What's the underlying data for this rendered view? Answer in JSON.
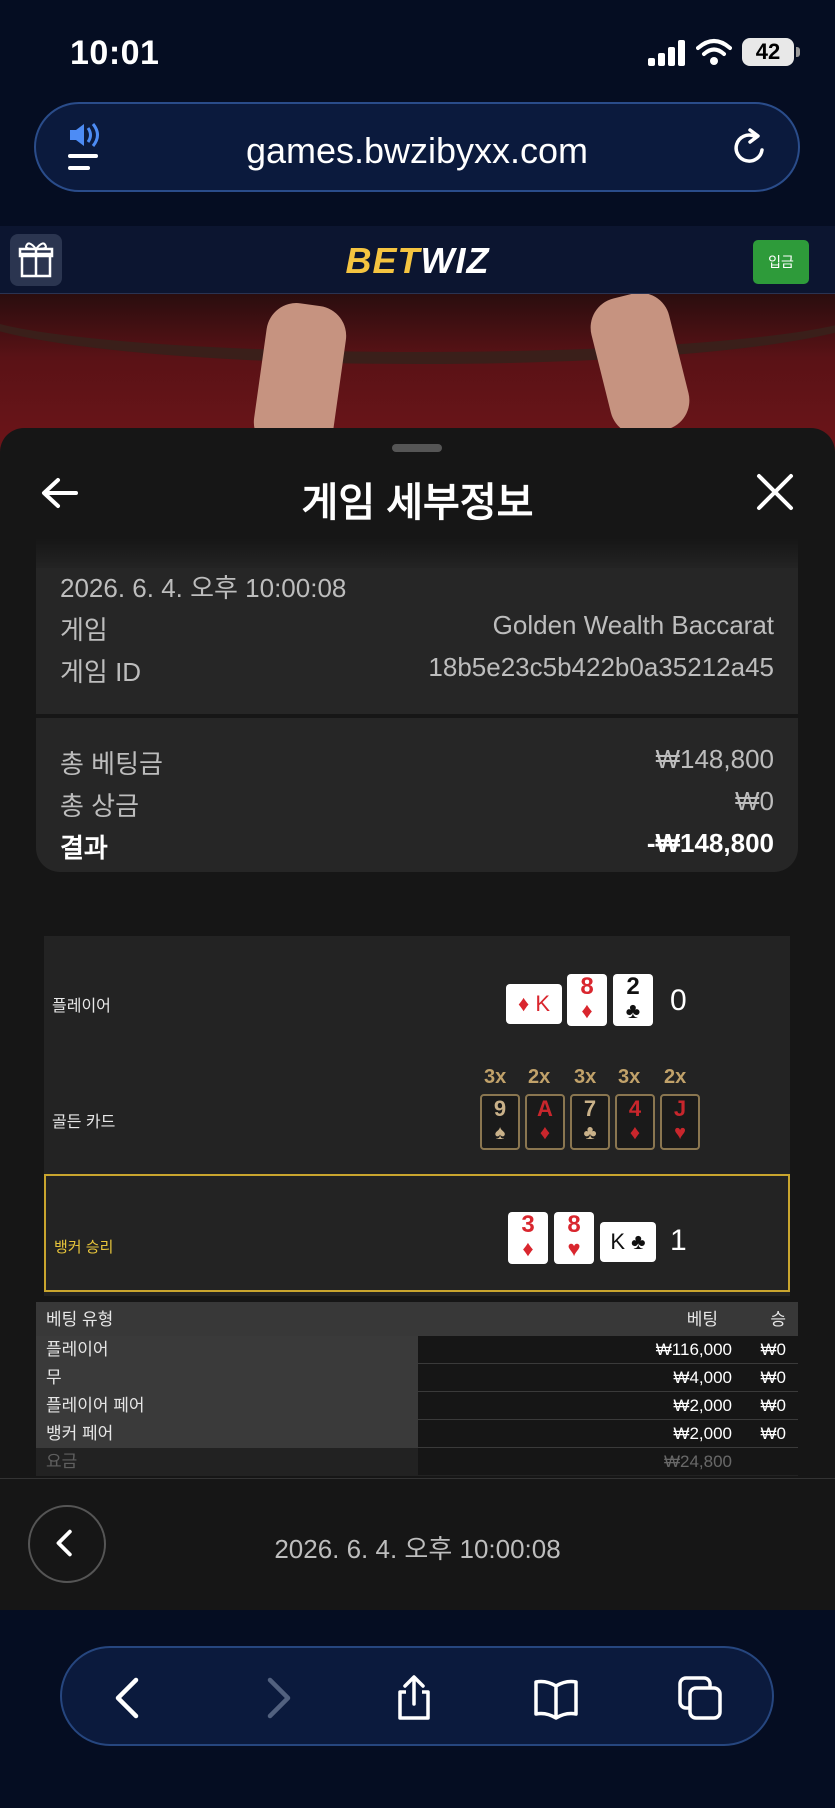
{
  "status_bar": {
    "time": "10:01",
    "battery": "42"
  },
  "browser": {
    "url": "games.bwzibyxx.com"
  },
  "site": {
    "logo_bet": "BET",
    "logo_wiz": "WIZ",
    "deposit_label": "입금"
  },
  "sheet": {
    "title": "게임 세부정보",
    "datetime": "2026. 6. 4. 오후 10:00:08",
    "details": [
      {
        "label": "게임",
        "value": "Golden Wealth Baccarat"
      },
      {
        "label": "게임 ID",
        "value": "18b5e23c5b422b0a35212a45"
      }
    ],
    "summary": [
      {
        "label": "총 베팅금",
        "value": "₩148,800"
      },
      {
        "label": "총 상금",
        "value": "₩0"
      },
      {
        "label": "결과",
        "value": "-₩148,800"
      }
    ]
  },
  "result": {
    "player_label": "플레이어",
    "player_score": "0",
    "player_cards": [
      {
        "rank": "8",
        "suit": "♦",
        "color": "#d9262e"
      },
      {
        "rank": "2",
        "suit": "♣",
        "color": "#111111"
      }
    ],
    "player_third_card": "♦ K",
    "golden_label": "골든 카드",
    "golden_cards": [
      {
        "mult": "3x",
        "rank": "9",
        "suit": "♠"
      },
      {
        "mult": "2x",
        "rank": "A",
        "suit": "♦"
      },
      {
        "mult": "3x",
        "rank": "7",
        "suit": "♣"
      },
      {
        "mult": "3x",
        "rank": "4",
        "suit": "♦"
      },
      {
        "mult": "2x",
        "rank": "J",
        "suit": "♥"
      }
    ],
    "banker_label": "뱅커 승리",
    "banker_score": "1",
    "banker_cards": [
      {
        "rank": "3",
        "suit": "♦",
        "color": "#d9262e"
      },
      {
        "rank": "8",
        "suit": "♥",
        "color": "#d9262e"
      }
    ],
    "banker_third_card": "K ♣",
    "win_color": "#c9a52e"
  },
  "bets": {
    "headers": {
      "type": "베팅 유형",
      "bet": "베팅",
      "win": "승"
    },
    "rows": [
      {
        "type": "플레이어",
        "bet": "₩116,000",
        "win": "₩0"
      },
      {
        "type": "무",
        "bet": "₩4,000",
        "win": "₩0"
      },
      {
        "type": "플레이어 페어",
        "bet": "₩2,000",
        "win": "₩0"
      },
      {
        "type": "뱅커 페어",
        "bet": "₩2,000",
        "win": "₩0"
      },
      {
        "type": "요금",
        "bet": "₩24,800",
        "win": ""
      }
    ]
  },
  "footer": {
    "datetime": "2026. 6. 4. 오후 10:00:08"
  }
}
